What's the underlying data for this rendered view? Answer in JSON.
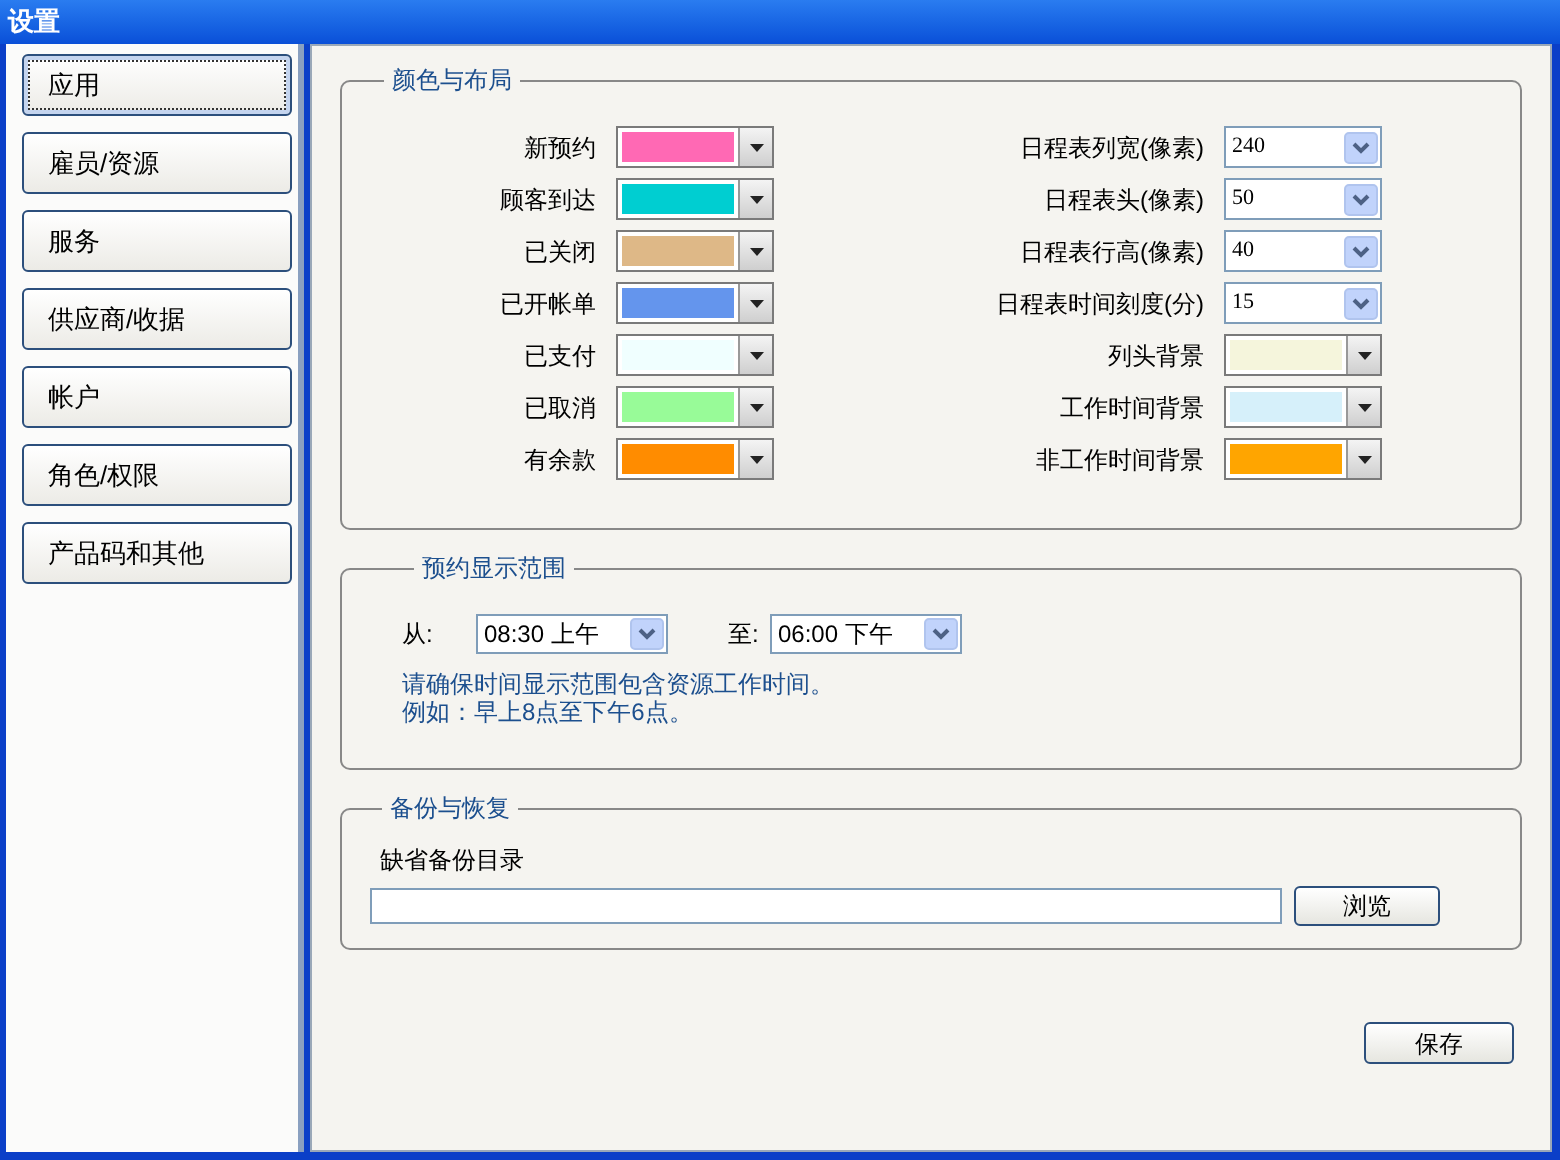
{
  "window": {
    "title": "设置"
  },
  "sidebar": {
    "items": [
      {
        "label": "应用",
        "selected": true
      },
      {
        "label": "雇员/资源",
        "selected": false
      },
      {
        "label": "服务",
        "selected": false
      },
      {
        "label": "供应商/收据",
        "selected": false
      },
      {
        "label": "帐户",
        "selected": false
      },
      {
        "label": "角色/权限",
        "selected": false
      },
      {
        "label": "产品码和其他",
        "selected": false
      }
    ]
  },
  "colors_layout": {
    "title": "颜色与布局",
    "left": [
      {
        "label": "新预约",
        "kind": "color",
        "color": "#ff69b4"
      },
      {
        "label": "顾客到达",
        "kind": "color",
        "color": "#00ced1"
      },
      {
        "label": "已关闭",
        "kind": "color",
        "color": "#deb887"
      },
      {
        "label": "已开帐单",
        "kind": "color",
        "color": "#6495ed"
      },
      {
        "label": "已支付",
        "kind": "color",
        "color": "#f0ffff"
      },
      {
        "label": "已取消",
        "kind": "color",
        "color": "#98fb98"
      },
      {
        "label": "有余款",
        "kind": "color",
        "color": "#ff8c00"
      }
    ],
    "right": [
      {
        "label": "日程表列宽(像素)",
        "kind": "select",
        "value": "240"
      },
      {
        "label": "日程表头(像素)",
        "kind": "select",
        "value": "50"
      },
      {
        "label": "日程表行高(像素)",
        "kind": "select",
        "value": "40"
      },
      {
        "label": "日程表时间刻度(分)",
        "kind": "select",
        "value": "15"
      },
      {
        "label": "列头背景",
        "kind": "color",
        "color": "#f5f5dc"
      },
      {
        "label": "工作时间背景",
        "kind": "color",
        "color": "#d6f0fa"
      },
      {
        "label": "非工作时间背景",
        "kind": "color",
        "color": "#ffa500"
      }
    ]
  },
  "display_range": {
    "title": "预约显示范围",
    "from_label": "从:",
    "from_value": "08:30 上午",
    "to_label": "至:",
    "to_value": "06:00 下午",
    "note": [
      "请确保时间显示范围包含资源工作时间。",
      "例如：早上8点至下午6点。"
    ]
  },
  "backup": {
    "title": "备份与恢复",
    "label": "缺省备份目录",
    "browse_button": "浏览"
  },
  "save_button": "保存"
}
